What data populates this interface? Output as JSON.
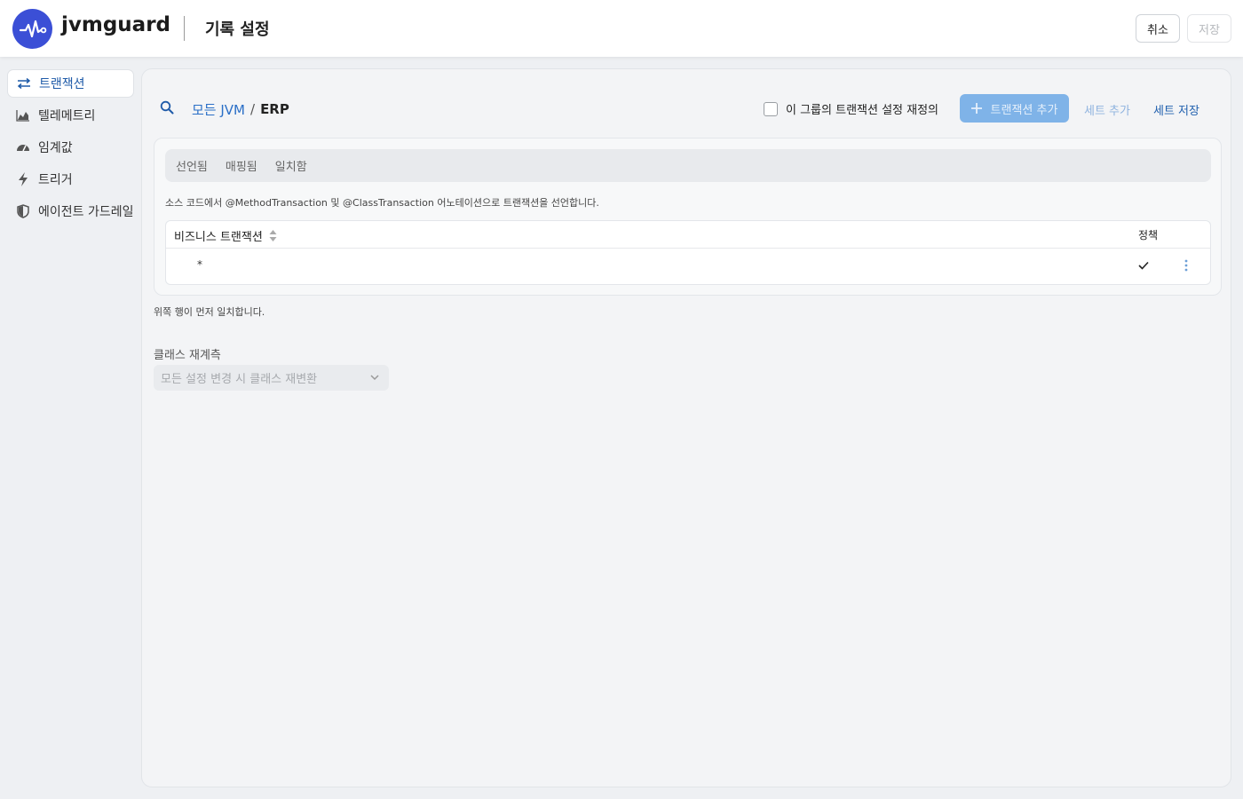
{
  "app": {
    "name": "jvmguard"
  },
  "header": {
    "title": "기록 설정",
    "cancel_label": "취소",
    "save_label": "저장"
  },
  "sidebar": {
    "items": [
      {
        "label": "트랜잭션",
        "icon": "transactions-icon",
        "active": true
      },
      {
        "label": "텔레메트리",
        "icon": "chart-icon"
      },
      {
        "label": "임계값",
        "icon": "gauge-icon"
      },
      {
        "label": "트리거",
        "icon": "lightning-icon"
      },
      {
        "label": "에이전트 가드레일",
        "icon": "shield-icon"
      }
    ]
  },
  "main": {
    "breadcrumb": {
      "root": "모든 JVM",
      "separator": "/",
      "current": "ERP"
    },
    "override_label": "이 그룹의 트랜잭션 설정 재정의",
    "add_transaction_label": "트랜잭션 추가",
    "add_set_label": "세트 추가",
    "save_set_label": "세트 저장",
    "tabs": [
      "선언됨",
      "매핑됨",
      "일치함"
    ],
    "description": "소스 코드에서 @MethodTransaction 및 @ClassTransaction 어노테이션으로 트랜잭션을 선언합니다.",
    "table": {
      "columns": [
        "비즈니스 트랜잭션",
        "정책"
      ],
      "rows": [
        {
          "name": "*"
        }
      ]
    },
    "note": "위쪽 행이 먼저 일치합니다.",
    "reclass": {
      "label": "클래스 재계측",
      "selected": "모든 설정 변경 시 클래스 재변환"
    }
  },
  "colors": {
    "brand": "#3b4fd6",
    "link": "#2a6fc7",
    "primary_button": "#7fb3e8"
  }
}
